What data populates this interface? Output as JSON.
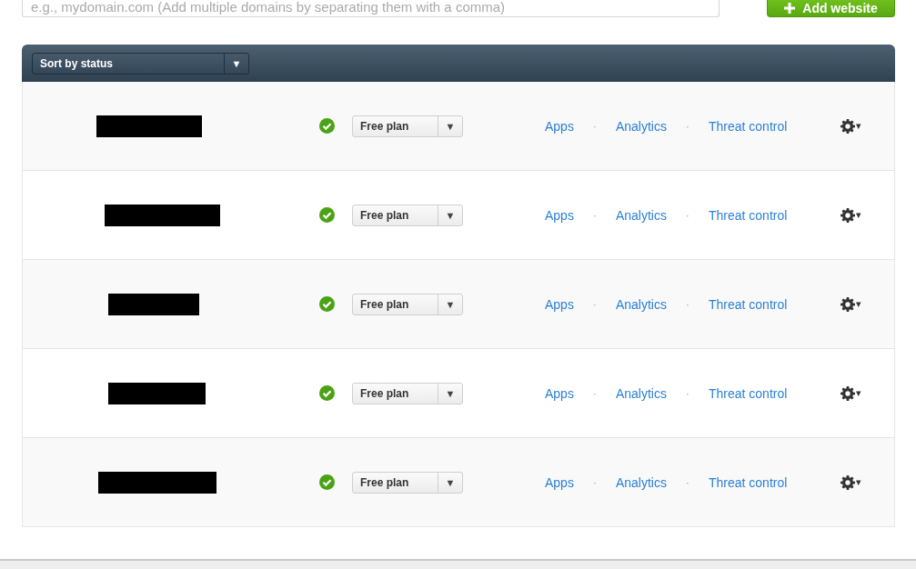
{
  "add_site": {
    "placeholder": "e.g., mydomain.com (Add multiple domains by separating them with a comma)",
    "button": "Add website"
  },
  "sort": {
    "label": "Sort by status",
    "caret": "▼"
  },
  "sites": [
    {
      "active": true,
      "plan": "Free plan",
      "caret": "▼",
      "links": [
        "Apps",
        "Analytics",
        "Threat control"
      ],
      "separator": "·",
      "menu_caret": "▾"
    },
    {
      "active": true,
      "plan": "Free plan",
      "caret": "▼",
      "links": [
        "Apps",
        "Analytics",
        "Threat control"
      ],
      "separator": "·",
      "menu_caret": "▾"
    },
    {
      "active": true,
      "plan": "Free plan",
      "caret": "▼",
      "links": [
        "Apps",
        "Analytics",
        "Threat control"
      ],
      "separator": "·",
      "menu_caret": "▾"
    },
    {
      "active": true,
      "plan": "Free plan",
      "caret": "▼",
      "links": [
        "Apps",
        "Analytics",
        "Threat control"
      ],
      "separator": "·",
      "menu_caret": "▾"
    },
    {
      "active": true,
      "plan": "Free plan",
      "caret": "▼",
      "links": [
        "Apps",
        "Analytics",
        "Threat control"
      ],
      "separator": "·",
      "menu_caret": "▾"
    }
  ]
}
